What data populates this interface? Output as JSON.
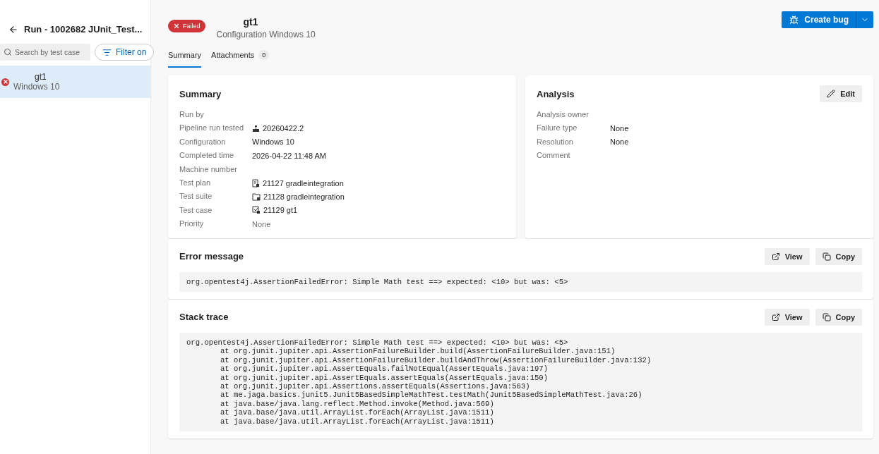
{
  "sidebar": {
    "title": "Run - 1002682 JUnit_Test...",
    "search": {
      "placeholder": "Search by test case"
    },
    "filter_button": "Filter on",
    "items": [
      {
        "name": "gt1",
        "configuration": "Windows 10",
        "kind": "failed",
        "selected": true
      }
    ]
  },
  "header": {
    "status": {
      "label": "Failed",
      "kind": "failed"
    },
    "title": "gt1",
    "subtitle": "Configuration Windows 10",
    "create_button": "Create bug"
  },
  "tabs": [
    {
      "label": "Summary",
      "selected": true
    },
    {
      "label": "Attachments",
      "count": "0",
      "selected": false
    }
  ],
  "summary": {
    "title": "Summary",
    "fields": [
      {
        "label": "Run by"
      },
      {
        "label": "Pipeline run tested",
        "value": "20260422.2",
        "kind": "pipeline"
      },
      {
        "label": "Configuration",
        "value": "Windows 10"
      },
      {
        "label": "Completed time",
        "value": "2026-04-22 11:48 AM"
      },
      {
        "label": "Machine number"
      },
      {
        "label": "Test plan",
        "value": "21127 gradleintegration",
        "kind": "plan"
      },
      {
        "label": "Test suite",
        "value": "21128 gradleintegration",
        "kind": "suite"
      },
      {
        "label": "Test case",
        "value": "21129 gt1",
        "kind": "case"
      },
      {
        "label": "Priority",
        "value": "None",
        "muted": true
      }
    ]
  },
  "analysis": {
    "title": "Analysis",
    "edit_button": "Edit",
    "fields": [
      {
        "label": "Analysis owner"
      },
      {
        "label": "Failure type",
        "value": "None"
      },
      {
        "label": "Resolution",
        "value": "None"
      },
      {
        "label": "Comment"
      }
    ]
  },
  "sections": [
    {
      "title": "Error message",
      "view_button": "View",
      "copy_button": "Copy",
      "lines": [
        {
          "text": "org.opentest4j.AssertionFailedError: Simple Math test ==> expected: <10> but was: <5>",
          "indented": false
        }
      ]
    },
    {
      "title": "Stack trace",
      "view_button": "View",
      "copy_button": "Copy",
      "lines": [
        {
          "text": "org.opentest4j.AssertionFailedError: Simple Math test ==> expected: <10> but was: <5>",
          "indented": false
        },
        {
          "text": "at org.junit.jupiter.api.AssertionFailureBuilder.build(AssertionFailureBuilder.java:151)",
          "indented": true
        },
        {
          "text": "at org.junit.jupiter.api.AssertionFailureBuilder.buildAndThrow(AssertionFailureBuilder.java:132)",
          "indented": true
        },
        {
          "text": "at org.junit.jupiter.api.AssertEquals.failNotEqual(AssertEquals.java:197)",
          "indented": true
        },
        {
          "text": "at org.junit.jupiter.api.AssertEquals.assertEquals(AssertEquals.java:150)",
          "indented": true
        },
        {
          "text": "at org.junit.jupiter.api.Assertions.assertEquals(Assertions.java:563)",
          "indented": true
        },
        {
          "text": "at me.jaga.basics.junit5.Junit5BasedSimpleMathTest.testMath(Junit5BasedSimpleMathTest.java:26)",
          "indented": true
        },
        {
          "text": "at java.base/java.lang.reflect.Method.invoke(Method.java:569)",
          "indented": true
        },
        {
          "text": "at java.base/java.util.ArrayList.forEach(ArrayList.java:1511)",
          "indented": true
        },
        {
          "text": "at java.base/java.util.ArrayList.forEach(ArrayList.java:1511)",
          "indented": true
        }
      ]
    }
  ]
}
